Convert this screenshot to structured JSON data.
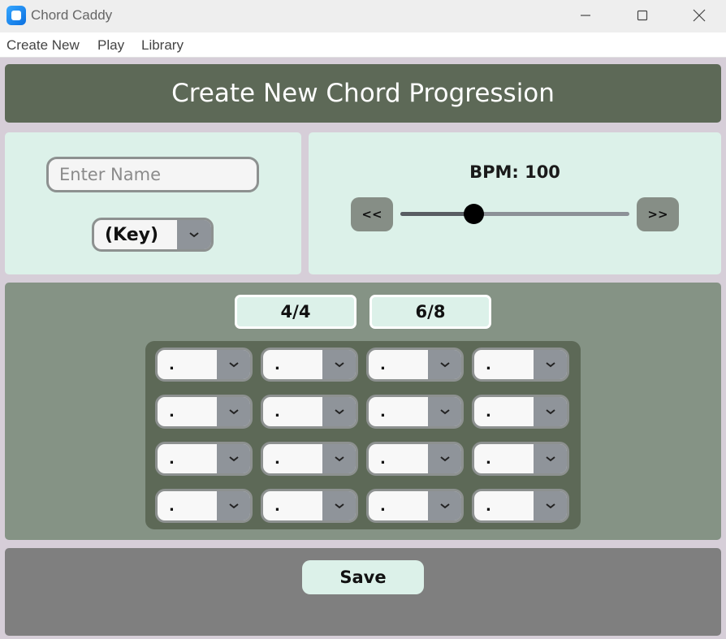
{
  "window": {
    "title": "Chord Caddy",
    "icon": "app-icon",
    "controls": [
      "minimize-icon",
      "maximize-icon",
      "close-icon"
    ]
  },
  "menu": {
    "items": [
      {
        "label": "Create New"
      },
      {
        "label": "Play"
      },
      {
        "label": "Library"
      }
    ]
  },
  "header": {
    "title": "Create New Chord Progression"
  },
  "name_input": {
    "value": "",
    "placeholder": "Enter Name"
  },
  "key_select": {
    "selected": "(Key)"
  },
  "tempo": {
    "label": "BPM: 100",
    "bpm": 100,
    "prev_label": "<<",
    "next_label": ">>",
    "slider_fraction": 0.32
  },
  "time_signatures": [
    {
      "label": "4/4"
    },
    {
      "label": "6/8"
    }
  ],
  "chord_grid": {
    "rows": [
      [
        ".",
        ".",
        ".",
        "."
      ],
      [
        ".",
        ".",
        ".",
        "."
      ],
      [
        ".",
        ".",
        ".",
        "."
      ],
      [
        ".",
        ".",
        ".",
        "."
      ]
    ]
  },
  "save": {
    "label": "Save"
  },
  "colors": {
    "header_bg": "#5d6957",
    "panel_light": "#dcf1e9",
    "panel_mid": "#859385",
    "panel_bottom": "#7f7f7f",
    "background": "#d6ced8",
    "button_gray": "#868e86",
    "dropdown_arrow_bg": "#8f949a"
  }
}
